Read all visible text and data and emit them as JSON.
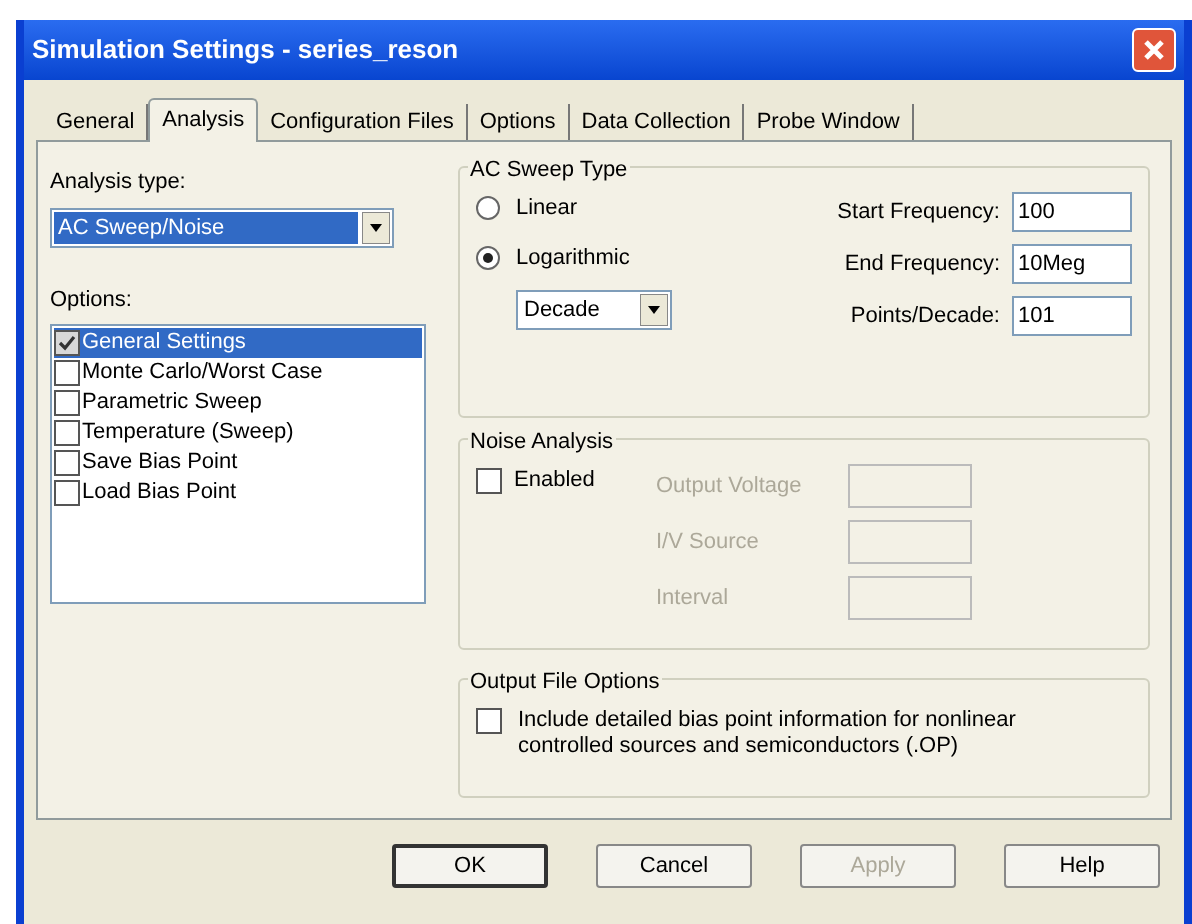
{
  "window": {
    "title": "Simulation Settings - series_reson"
  },
  "tabs": [
    {
      "label": "General",
      "selected": false
    },
    {
      "label": "Analysis",
      "selected": true
    },
    {
      "label": "Configuration Files",
      "selected": false
    },
    {
      "label": "Options",
      "selected": false
    },
    {
      "label": "Data Collection",
      "selected": false
    },
    {
      "label": "Probe Window",
      "selected": false
    }
  ],
  "analysis_type": {
    "label": "Analysis type:",
    "value": "AC Sweep/Noise"
  },
  "options": {
    "label": "Options:",
    "items": [
      {
        "label": "General Settings",
        "checked": true,
        "selected": true
      },
      {
        "label": "Monte Carlo/Worst Case",
        "checked": false,
        "selected": false
      },
      {
        "label": "Parametric Sweep",
        "checked": false,
        "selected": false
      },
      {
        "label": "Temperature (Sweep)",
        "checked": false,
        "selected": false
      },
      {
        "label": "Save Bias Point",
        "checked": false,
        "selected": false
      },
      {
        "label": "Load Bias Point",
        "checked": false,
        "selected": false
      }
    ]
  },
  "ac_sweep": {
    "title": "AC Sweep Type",
    "radios": [
      {
        "label": "Linear",
        "selected": false
      },
      {
        "label": "Logarithmic",
        "selected": true
      }
    ],
    "scale": "Decade",
    "fields": [
      {
        "label": "Start Frequency:",
        "value": "100"
      },
      {
        "label": "End Frequency:",
        "value": "10Meg"
      },
      {
        "label": "Points/Decade:",
        "value": "101"
      }
    ]
  },
  "noise": {
    "title": "Noise Analysis",
    "enabled": {
      "label": "Enabled",
      "checked": false
    },
    "fields": [
      {
        "label": "Output Voltage",
        "disabled": true
      },
      {
        "label": "I/V Source",
        "disabled": true
      },
      {
        "label": "Interval",
        "disabled": true
      }
    ]
  },
  "output_file": {
    "title": "Output File Options",
    "option": {
      "label": "Include detailed bias point information for nonlinear controlled sources and semiconductors (.OP)",
      "checked": false
    }
  },
  "buttons": [
    {
      "label": "OK",
      "disabled": false,
      "default": true
    },
    {
      "label": "Cancel",
      "disabled": false,
      "default": false
    },
    {
      "label": "Apply",
      "disabled": true,
      "default": false
    },
    {
      "label": "Help",
      "disabled": false,
      "default": false
    }
  ]
}
